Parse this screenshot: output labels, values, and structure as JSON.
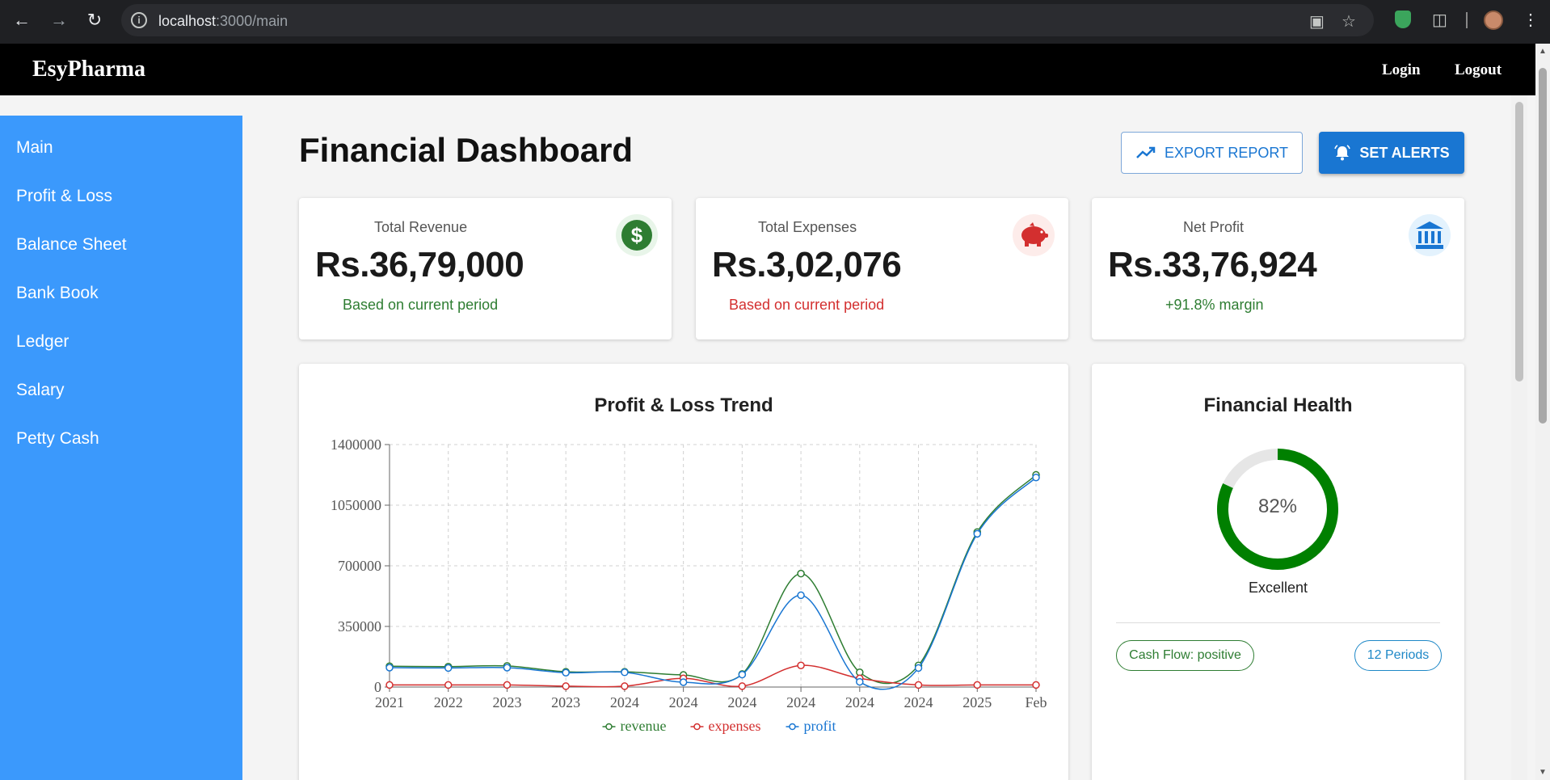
{
  "browser": {
    "url_host": "localhost",
    "url_path": ":3000/main"
  },
  "header": {
    "brand": "EsyPharma",
    "login": "Login",
    "logout": "Logout"
  },
  "sidebar": {
    "items": [
      {
        "label": "Main"
      },
      {
        "label": "Profit & Loss"
      },
      {
        "label": "Balance Sheet"
      },
      {
        "label": "Bank Book"
      },
      {
        "label": "Ledger"
      },
      {
        "label": "Salary"
      },
      {
        "label": "Petty Cash"
      }
    ]
  },
  "main": {
    "title": "Financial Dashboard",
    "export_label": "EXPORT REPORT",
    "alerts_label": "SET ALERTS"
  },
  "stats": [
    {
      "label": "Total Revenue",
      "value": "Rs.36,79,000",
      "note": "Based on current period",
      "note_color": "#2e7d32",
      "icon": "dollar-icon",
      "icon_color": "#2e7d32",
      "icon_bg": "#e8f5e9"
    },
    {
      "label": "Total Expenses",
      "value": "Rs.3,02,076",
      "note": "Based on current period",
      "note_color": "#d32f2f",
      "icon": "piggy-bank-icon",
      "icon_color": "#d32f2f",
      "icon_bg": "#fdecea"
    },
    {
      "label": "Net Profit",
      "value": "Rs.33,76,924",
      "note": "+91.8% margin",
      "note_color": "#2e7d32",
      "icon": "bank-icon",
      "icon_color": "#1976d2",
      "icon_bg": "#e3f2fd"
    }
  ],
  "health": {
    "title": "Financial Health",
    "percent": 82,
    "percent_label": "82%",
    "status": "Excellent",
    "ring_color": "#008000",
    "chips": {
      "cash_flow": "Cash Flow: positive",
      "periods": "12 Periods"
    }
  },
  "chart_data": {
    "type": "line",
    "title": "Profit & Loss Trend",
    "categories": [
      "2021",
      "2022",
      "2023",
      "2023",
      "2024",
      "2024",
      "2024",
      "2024",
      "2024",
      "2024",
      "2025",
      "Feb"
    ],
    "ylim": [
      0,
      1400000
    ],
    "yticks": [
      "0",
      "350000",
      "700000",
      "1050000",
      "1400000"
    ],
    "grid": true,
    "legend": "bottom",
    "series": [
      {
        "name": "revenue",
        "color": "#2e7d32",
        "values": [
          120000,
          118000,
          122000,
          88000,
          88000,
          70000,
          75000,
          655000,
          85000,
          125000,
          895000,
          1225000
        ]
      },
      {
        "name": "expenses",
        "color": "#d32f2f",
        "values": [
          12000,
          12000,
          12000,
          5000,
          5000,
          50000,
          5000,
          125000,
          50000,
          12000,
          12000,
          12000
        ]
      },
      {
        "name": "profit",
        "color": "#1976d2",
        "values": [
          112000,
          110000,
          112000,
          83000,
          85000,
          28000,
          72000,
          530000,
          30000,
          110000,
          885000,
          1210000
        ]
      }
    ]
  }
}
